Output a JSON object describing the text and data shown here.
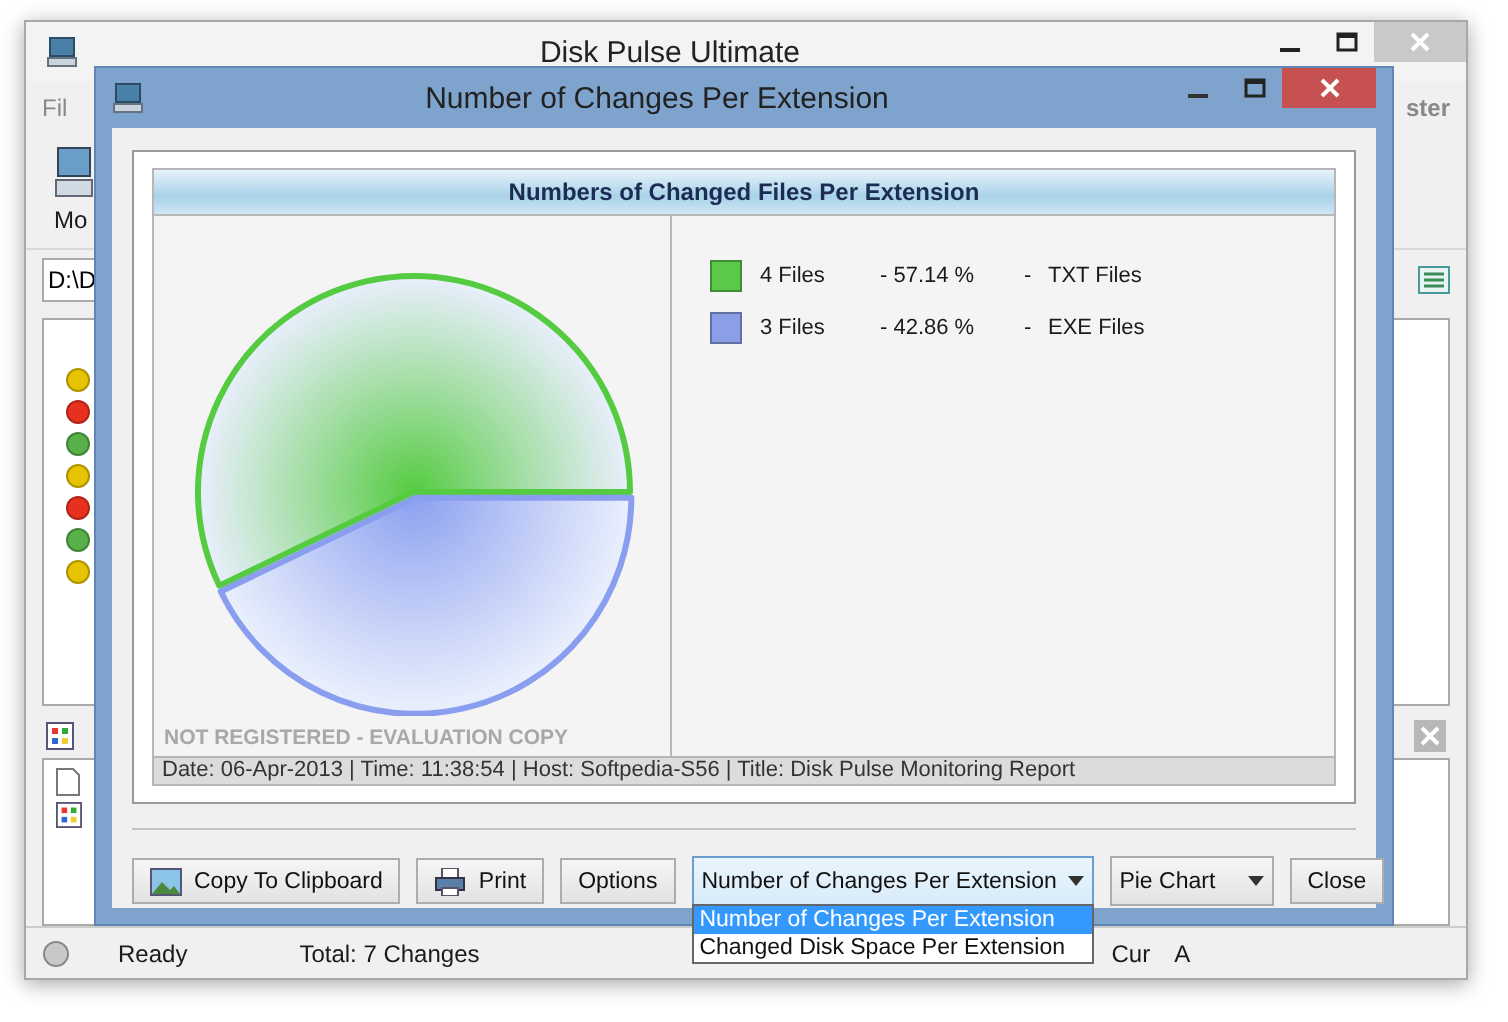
{
  "main_window": {
    "title": "Disk Pulse Ultimate",
    "menu": [
      "Fil",
      "ster"
    ],
    "toolbar_label": "Mo",
    "path_field": {
      "value": "D:\\D"
    },
    "status_dots": [
      {
        "color": "#e8c400"
      },
      {
        "color": "#e83020"
      },
      {
        "color": "#58b048"
      },
      {
        "color": "#e8c400"
      },
      {
        "color": "#e83020"
      },
      {
        "color": "#58b048"
      },
      {
        "color": "#e8c400"
      }
    ],
    "status_bar": [
      "Ready",
      "Total: 7 Changes",
      "Cur",
      "A"
    ]
  },
  "dialog": {
    "title": "Number of Changes Per Extension",
    "chart": {
      "title": "Numbers of Changed Files Per Extension",
      "watermark": "NOT REGISTERED - EVALUATION COPY",
      "chart_data": {
        "type": "pie",
        "categories": [
          "TXT Files",
          "EXE Files"
        ],
        "values": [
          57.14,
          42.86
        ]
      },
      "legend": [
        {
          "count": "4 Files",
          "percent": "-  57.14 %",
          "separator": "-",
          "color": "#5cc84a"
        },
        {
          "count": "3 Files",
          "percent": "-  42.86 %",
          "separator": "-",
          "color": "#8c9ee8"
        }
      ],
      "footer": "Date: 06-Apr-2013 | Time: 11:38:54 | Host: Softpedia-S56 | Title: Disk Pulse Monitoring Report"
    },
    "buttons": [
      {
        "label": "Copy To Clipboard",
        "kind": "image"
      },
      {
        "label": "Print",
        "kind": "printer"
      },
      {
        "label": "Options",
        "kind": "plain"
      }
    ],
    "report_select": {
      "value": "Number of Changes Per Extension",
      "expanded": true,
      "options": [
        {
          "label": "Number of Changes Per Extension",
          "selected": true
        },
        {
          "label": "Changed Disk Space Per Extension",
          "selected": false
        }
      ]
    },
    "chart_type_select": {
      "value": "Pie Chart"
    },
    "close_button": "Close"
  }
}
